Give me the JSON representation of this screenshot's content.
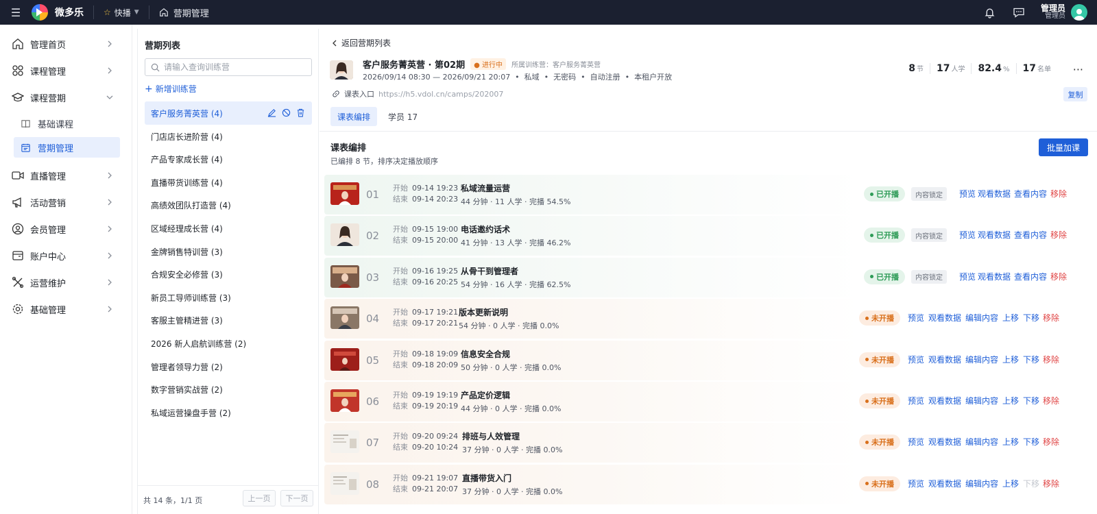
{
  "topbar": {
    "brand": "微多乐",
    "quick": "快播",
    "breadcrumb": "营期管理",
    "user_name": "管理员",
    "user_role": "管理员"
  },
  "sidebar": {
    "items": [
      {
        "label": "管理首页",
        "icon": "home-icon"
      },
      {
        "label": "课程管理",
        "icon": "grid-icon"
      },
      {
        "label": "课程营期",
        "icon": "graduation-cap-icon"
      },
      {
        "label": "直播管理",
        "icon": "video-icon"
      },
      {
        "label": "活动营销",
        "icon": "megaphone-icon"
      },
      {
        "label": "会员管理",
        "icon": "user-circle-icon"
      },
      {
        "label": "账户中心",
        "icon": "wallet-icon"
      },
      {
        "label": "运营维护",
        "icon": "tools-icon"
      },
      {
        "label": "基础管理",
        "icon": "gear-icon"
      }
    ],
    "sub_items": [
      {
        "label": "基础课程",
        "icon": "book-icon"
      },
      {
        "label": "营期管理",
        "icon": "calendar-icon"
      }
    ]
  },
  "camps": {
    "title": "营期列表",
    "search_placeholder": "请输入查询训练营",
    "add_label": "新增训练营",
    "items": [
      "客户服务菁英营 (4)",
      "门店店长进阶营 (4)",
      "产品专家成长营 (4)",
      "直播带货训练营 (4)",
      "高绩效团队打造营 (4)",
      "区域经理成长营 (4)",
      "金牌销售特训营 (3)",
      "合规安全必修营 (3)",
      "新员工导师训练营 (3)",
      "客服主管精进营 (3)",
      "2026 新人启航训练营 (2)",
      "管理者领导力营 (2)",
      "数字营销实战营 (2)",
      "私域运营操盘手营 (2)"
    ],
    "footer": "共 14 条，1/1 页",
    "prev": "上一页",
    "next": "下一页"
  },
  "detail": {
    "back": "返回营期列表",
    "title": "客户服务菁英营 · 第02期",
    "status": "进行中",
    "belong": "所属训练营：客户服务菁英营",
    "meta": "2026/09/14 08:30 — 2026/09/21 20:07  •  私域  •  无密码  •  自动注册  •  本租户开放",
    "link_label": "课表入口",
    "link_url": "https://h5.vdol.cn/camps/202007",
    "copy": "复制",
    "stats": [
      {
        "value": "8",
        "unit": "节"
      },
      {
        "value": "17",
        "unit": "人学"
      },
      {
        "value": "82.4",
        "unit": "%"
      },
      {
        "value": "17",
        "unit": "名单"
      }
    ],
    "tabs": [
      "课表编排",
      "学员 17"
    ],
    "section_title": "课表编排",
    "section_sub": "已编排 8 节，排序决定播放顺序",
    "batch_add": "批量加课"
  },
  "labels": {
    "start": "开始",
    "end": "结束",
    "lock": "内容锁定",
    "preview": "预览",
    "watch_data": "观看数据",
    "view_content": "查看内容",
    "edit_content": "编辑内容",
    "up": "上移",
    "down": "下移",
    "remove": "移除"
  },
  "lessons": [
    {
      "no": "01",
      "start": "09-14 19:23",
      "end": "09-14 20:23",
      "title": "私域流量运营",
      "info": "44 分钟 · 11 人学 · 完播 54.5%",
      "status": "已开播"
    },
    {
      "no": "02",
      "start": "09-15 19:00",
      "end": "09-15 20:00",
      "title": "电话邀约话术",
      "info": "41 分钟 · 13 人学 · 完播 46.2%",
      "status": "已开播"
    },
    {
      "no": "03",
      "start": "09-16 19:25",
      "end": "09-16 20:25",
      "title": "从骨干到管理者",
      "info": "54 分钟 · 16 人学 · 完播 62.5%",
      "status": "已开播"
    },
    {
      "no": "04",
      "start": "09-17 19:21",
      "end": "09-17 20:21",
      "title": "版本更新说明",
      "info": "54 分钟 · 0 人学 · 完播 0.0%",
      "status": "未开播"
    },
    {
      "no": "05",
      "start": "09-18 19:09",
      "end": "09-18 20:09",
      "title": "信息安全合规",
      "info": "50 分钟 · 0 人学 · 完播 0.0%",
      "status": "未开播"
    },
    {
      "no": "06",
      "start": "09-19 19:19",
      "end": "09-19 20:19",
      "title": "产品定价逻辑",
      "info": "44 分钟 · 0 人学 · 完播 0.0%",
      "status": "未开播"
    },
    {
      "no": "07",
      "start": "09-20 09:24",
      "end": "09-20 10:24",
      "title": "排班与人效管理",
      "info": "37 分钟 · 0 人学 · 完播 0.0%",
      "status": "未开播"
    },
    {
      "no": "08",
      "start": "09-21 19:07",
      "end": "09-21 20:07",
      "title": "直播带货入门",
      "info": "37 分钟 · 0 人学 · 完播 0.0%",
      "status": "未开播"
    }
  ]
}
